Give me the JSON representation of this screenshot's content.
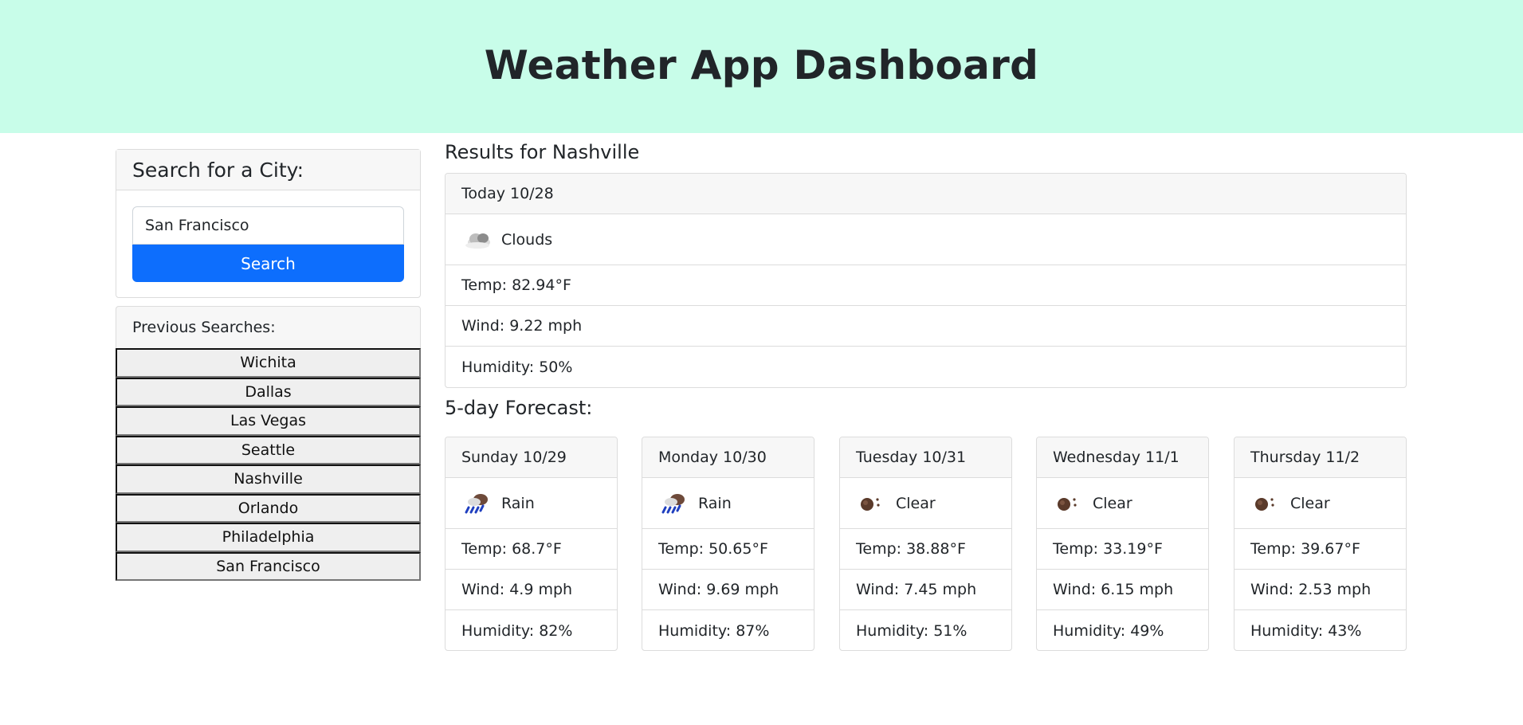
{
  "header": {
    "title": "Weather App Dashboard"
  },
  "search": {
    "title": "Search for a City:",
    "input_value": "San Francisco",
    "button_label": "Search"
  },
  "previous": {
    "title": "Previous Searches:",
    "items": [
      "Wichita",
      "Dallas",
      "Las Vegas",
      "Seattle",
      "Nashville",
      "Orlando",
      "Philadelphia",
      "San Francisco"
    ]
  },
  "results": {
    "title": "Results for Nashville",
    "today": {
      "date": "Today 10/28",
      "icon": "clouds-icon",
      "condition": "Clouds",
      "temp": "Temp: 82.94°F",
      "wind": "Wind: 9.22 mph",
      "humidity": "Humidity: 50%"
    }
  },
  "forecast": {
    "title": "5-day Forecast:",
    "days": [
      {
        "date": "Sunday 10/29",
        "icon": "rain-icon",
        "condition": "Rain",
        "temp": "Temp: 68.7°F",
        "wind": "Wind: 4.9 mph",
        "humidity": "Humidity: 82%"
      },
      {
        "date": "Monday 10/30",
        "icon": "rain-icon",
        "condition": "Rain",
        "temp": "Temp: 50.65°F",
        "wind": "Wind: 9.69 mph",
        "humidity": "Humidity: 87%"
      },
      {
        "date": "Tuesday 10/31",
        "icon": "clear-night-icon",
        "condition": "Clear",
        "temp": "Temp: 38.88°F",
        "wind": "Wind: 7.45 mph",
        "humidity": "Humidity: 51%"
      },
      {
        "date": "Wednesday 11/1",
        "icon": "clear-night-icon",
        "condition": "Clear",
        "temp": "Temp: 33.19°F",
        "wind": "Wind: 6.15 mph",
        "humidity": "Humidity: 49%"
      },
      {
        "date": "Thursday 11/2",
        "icon": "clear-night-icon",
        "condition": "Clear",
        "temp": "Temp: 39.67°F",
        "wind": "Wind: 2.53 mph",
        "humidity": "Humidity: 43%"
      }
    ]
  },
  "colors": {
    "header_bg": "#c8fde9",
    "primary": "#0d6efd"
  }
}
